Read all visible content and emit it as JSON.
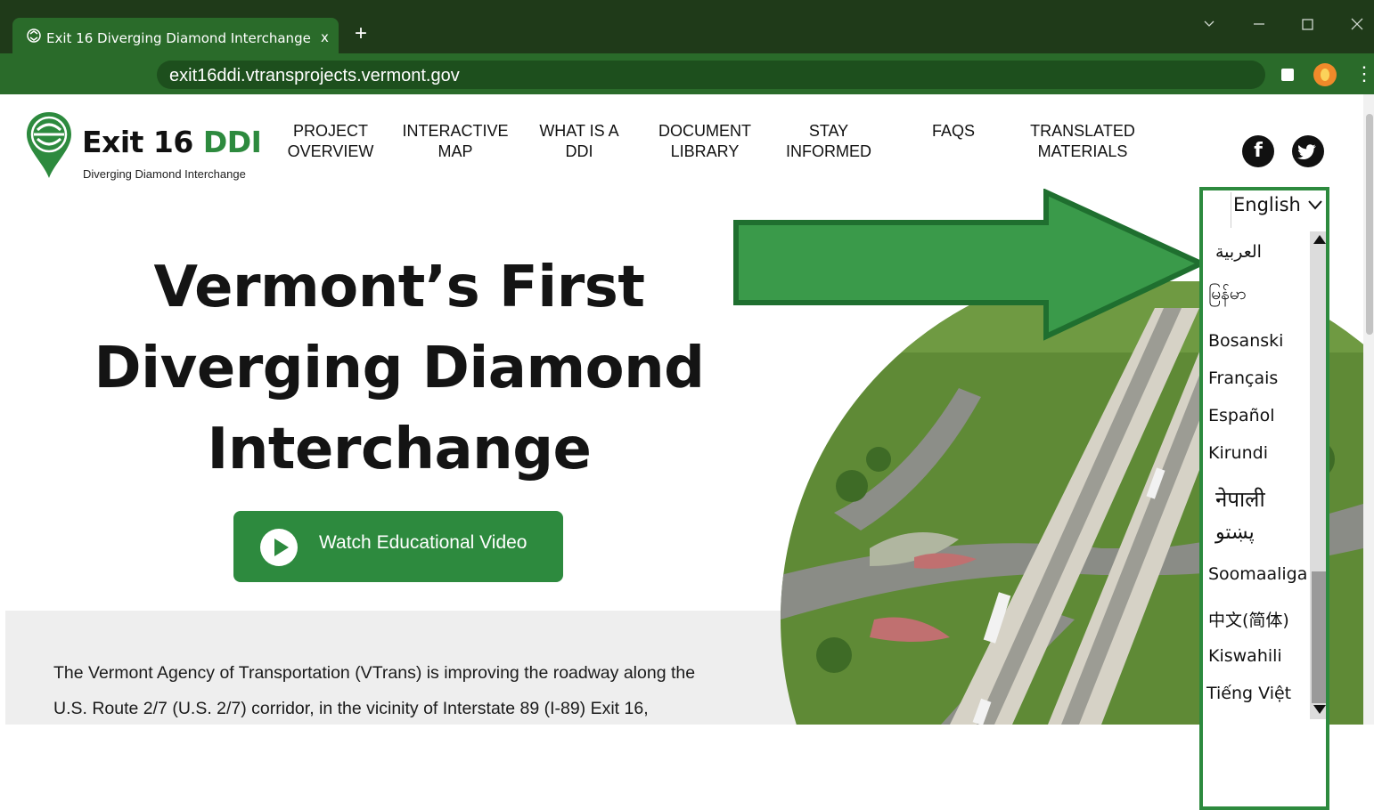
{
  "browser": {
    "tab_title": "Exit 16 Diverging Diamond Interchange",
    "tab_close": "x",
    "new_tab": "+",
    "url": "exit16ddi.vtransprojects.vermont.gov",
    "menu": "⋮",
    "colors": {
      "frame": "#1f3a19",
      "toolbar": "#2a6b2a"
    }
  },
  "logo": {
    "word": "Exit 16 ",
    "accent": "DDI",
    "subtitle": "Diverging Diamond Interchange"
  },
  "nav": {
    "items": [
      {
        "line1": "PROJECT",
        "line2": "OVERVIEW"
      },
      {
        "line1": "INTERACTIVE",
        "line2": "MAP"
      },
      {
        "line1": "WHAT IS A",
        "line2": "DDI"
      },
      {
        "line1": "DOCUMENT",
        "line2": "LIBRARY"
      },
      {
        "line1": "STAY",
        "line2": "INFORMED"
      },
      {
        "line1": "FAQS",
        "line2": ""
      },
      {
        "line1": "TRANSLATED",
        "line2": "MATERIALS"
      }
    ]
  },
  "social": {
    "facebook": "f"
  },
  "hero": {
    "line1": "Vermont’s First",
    "line2": "Diverging Diamond",
    "line3": "Interchange",
    "button_label": "Watch Educational Video"
  },
  "intro": {
    "line1": "The Vermont Agency of Transportation (VTrans) is improving the roadway along the",
    "line2": "U.S. Route 2/7 (U.S. 2/7) corridor, in the vicinity of Interstate 89 (I-89) Exit 16,"
  },
  "language": {
    "selected": "English",
    "options": [
      "العربية",
      "မြန်မာ",
      "Bosanski",
      "Français",
      "Español",
      "Kirundi",
      "नेपाली",
      "پښتو",
      "Soomaaliga",
      "中文(简体)",
      "Kiswahili",
      "Tiếng Việt"
    ]
  },
  "colors": {
    "brand_green": "#2d8a3e",
    "arrow_green": "#3a9a4a"
  }
}
